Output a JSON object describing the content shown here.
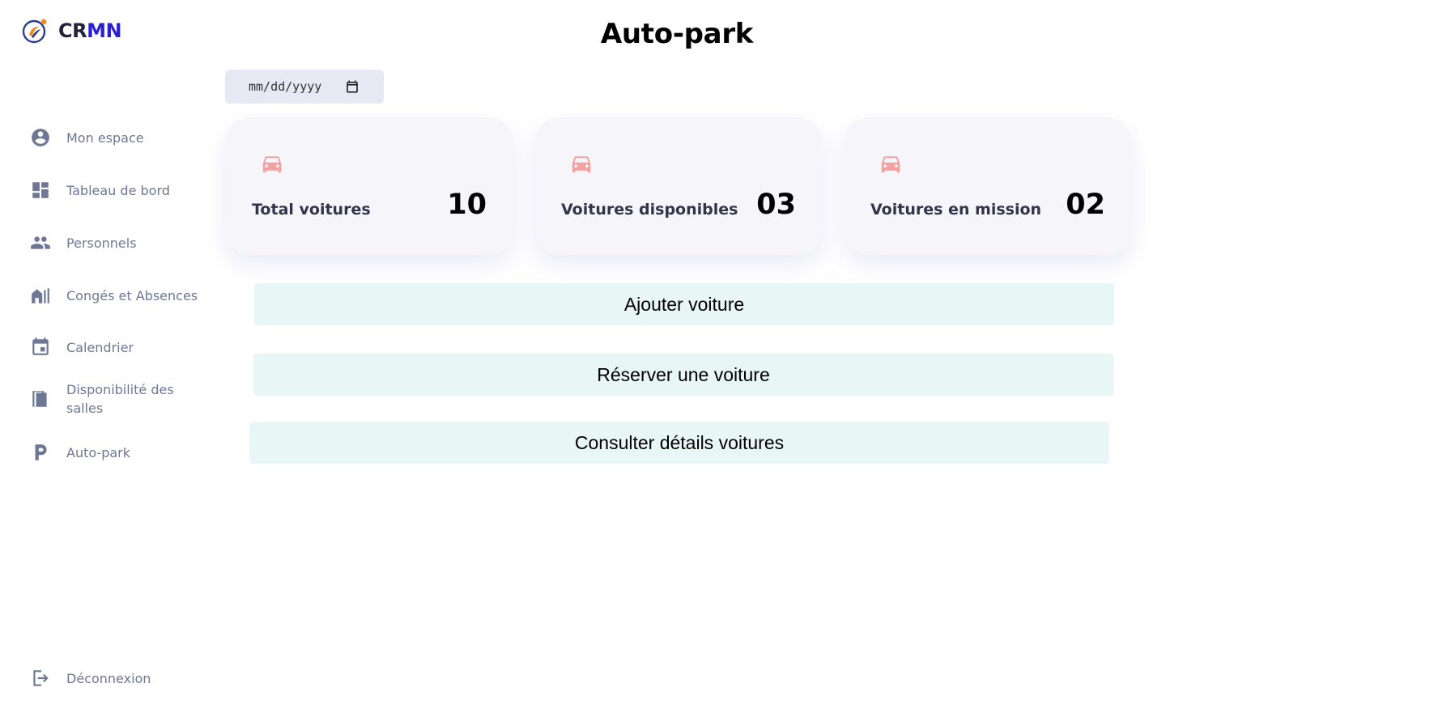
{
  "brand": {
    "name_part1": "CR",
    "name_part2": "MN"
  },
  "sidebar": {
    "items": [
      {
        "label": "Mon espace",
        "icon": "account-circle-icon"
      },
      {
        "label": "Tableau de bord",
        "icon": "dashboard-icon"
      },
      {
        "label": "Personnels",
        "icon": "people-icon"
      },
      {
        "label": "Congés et Absences",
        "icon": "absence-icon"
      },
      {
        "label": "Calendrier",
        "icon": "calendar-icon"
      },
      {
        "label": "Disponibilité des salles",
        "icon": "door-icon"
      },
      {
        "label": "Auto-park",
        "icon": "parking-icon"
      }
    ],
    "logout_label": "Déconnexion"
  },
  "main": {
    "title": "Auto-park",
    "date_input": {
      "placeholder": "mm/dd/yyyy"
    },
    "stats": [
      {
        "label": "Total voitures",
        "value": "10"
      },
      {
        "label": "Voitures disponibles",
        "value": "03"
      },
      {
        "label": "Voitures en mission",
        "value": "02"
      }
    ],
    "actions": {
      "add_car": "Ajouter voiture",
      "reserve_car": "Réserver une voiture",
      "view_details": "Consulter détails voitures"
    }
  },
  "colors": {
    "brand_accent": "#2a1fd6",
    "nav_text": "#6e7795",
    "card_bg": "#f6f6fa",
    "car_icon": "#f4a1a1",
    "button_bg": "#e9f6f6",
    "date_bg": "#e7e8f4"
  }
}
